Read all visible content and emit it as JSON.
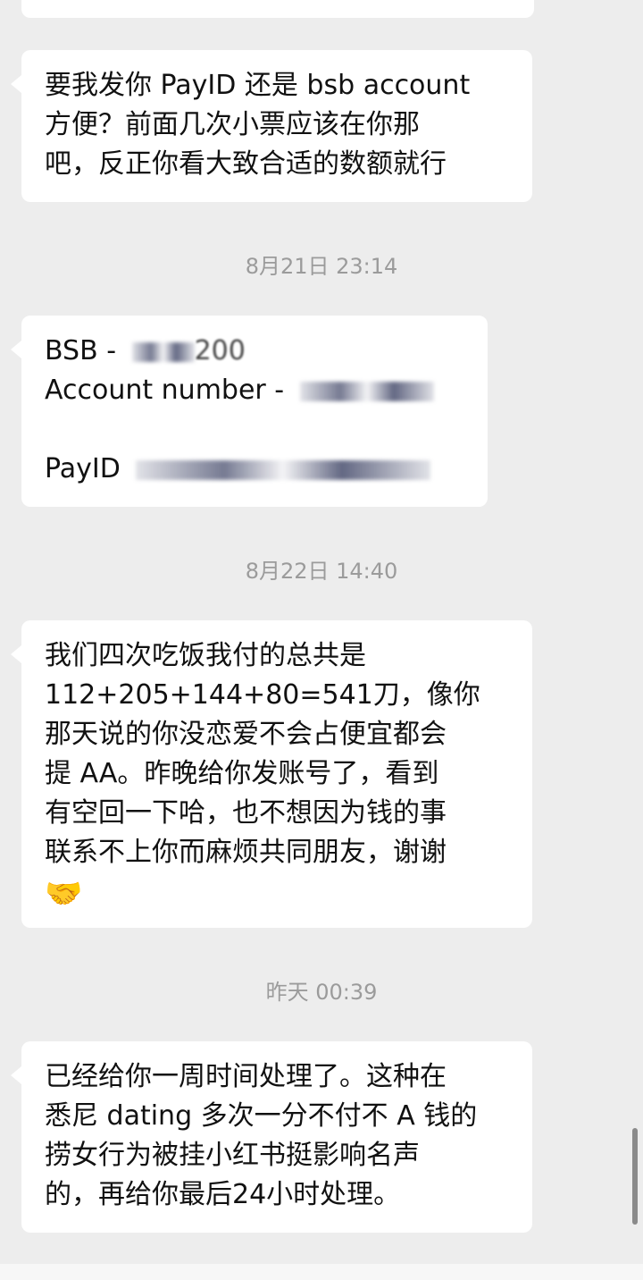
{
  "messages": [
    {
      "lines": []
    },
    {
      "lines": [
        "要我发你 PayID 还是 bsb account",
        "方便？前面几次小票应该在你那",
        "吧，反正你看大致合适的数额就行"
      ]
    },
    {
      "bsb_label": "BSB - ",
      "bsb_visible": "200",
      "account_label": "Account number - ",
      "payid_label": "PayID "
    },
    {
      "lines": [
        "我们四次吃饭我付的总共是",
        "112+205+144+80=541刀，像你",
        "那天说的你没恋爱不会占便宜都会",
        "提 AA。昨晚给你发账号了，看到",
        "有空回一下哈，也不想因为钱的事",
        "联系不上你而麻烦共同朋友，谢谢"
      ],
      "emoji": "🤝"
    },
    {
      "lines": [
        "已经给你一周时间处理了。这种在",
        "悉尼 dating 多次一分不付不 A 钱的",
        "捞女行为被挂小红书挺影响名声",
        "的，再给你最后24小时处理。"
      ]
    }
  ],
  "timestamps": [
    "8月21日 23:14",
    "8月22日 14:40",
    "昨天 00:39"
  ]
}
